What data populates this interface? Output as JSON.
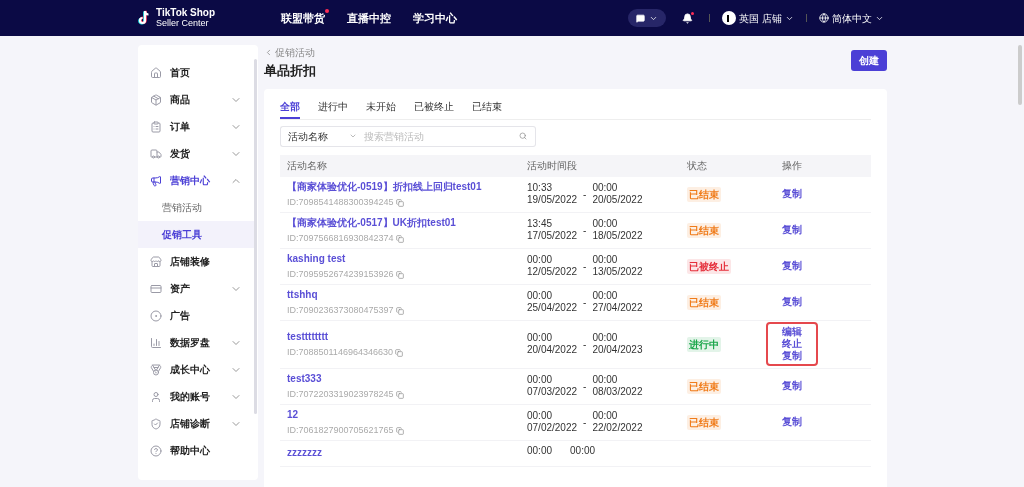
{
  "header": {
    "logo_title": "TikTok Shop",
    "logo_subtitle": "Seller Center",
    "nav": [
      {
        "label": "联盟带货",
        "dot": true
      },
      {
        "label": "直播中控",
        "dot": false
      },
      {
        "label": "学习中心",
        "dot": false
      }
    ],
    "bell_dot": true,
    "store": "英国 店铺",
    "language": "简体中文"
  },
  "sidebar": {
    "items": [
      {
        "label": "首页",
        "selected": false
      },
      {
        "label": "商品",
        "selected": false,
        "expanded": false
      },
      {
        "label": "订单",
        "selected": false,
        "expanded": false
      },
      {
        "label": "发货",
        "selected": false,
        "expanded": false
      },
      {
        "label": "营销中心",
        "selected": true,
        "expanded": true,
        "children": [
          {
            "label": "营销活动",
            "selected": false
          },
          {
            "label": "促销工具",
            "selected": true
          }
        ]
      },
      {
        "label": "店铺装修",
        "selected": false
      },
      {
        "label": "资产",
        "selected": false,
        "expanded": false
      },
      {
        "label": "广告",
        "selected": false
      },
      {
        "label": "数据罗盘",
        "selected": false,
        "expanded": false
      },
      {
        "label": "成长中心",
        "selected": false,
        "expanded": false
      },
      {
        "label": "我的账号",
        "selected": false,
        "expanded": false
      },
      {
        "label": "店铺诊断",
        "selected": false,
        "expanded": false
      },
      {
        "label": "帮助中心",
        "selected": false
      }
    ]
  },
  "breadcrumb": "促销活动",
  "title": "单品折扣",
  "create_button": "创建",
  "tabs": [
    {
      "label": "全部",
      "selected": true
    },
    {
      "label": "进行中",
      "selected": false
    },
    {
      "label": "未开始",
      "selected": false
    },
    {
      "label": "已被终止",
      "selected": false
    },
    {
      "label": "已结束",
      "selected": false
    }
  ],
  "filter": {
    "field": "活动名称",
    "placeholder": "搜索营销活动"
  },
  "table": {
    "columns": [
      "活动名称",
      "活动时间段",
      "状态",
      "操作"
    ],
    "rows": [
      {
        "name": "【商家体验优化-0519】折扣线上回归test01",
        "id": "ID:7098541488300394245",
        "start_time": "10:33",
        "start_date": "19/05/2022",
        "separator": "-",
        "end_time": "00:00",
        "end_date": "20/05/2022",
        "status": {
          "label": "已结束",
          "color": "#f07c1b"
        },
        "actions": [
          "复制"
        ],
        "highlighted": false
      },
      {
        "name": "【商家体验优化-0517】UK折扣test01",
        "id": "ID:7097566816930842374",
        "start_time": "13:45",
        "start_date": "17/05/2022",
        "separator": "-",
        "end_time": "00:00",
        "end_date": "18/05/2022",
        "status": {
          "label": "已结束",
          "color": "#f07c1b"
        },
        "actions": [
          "复制"
        ],
        "highlighted": false
      },
      {
        "name": "kashing test",
        "id": "ID:7095952674239153926",
        "start_time": "00:00",
        "start_date": "12/05/2022",
        "separator": "-",
        "end_time": "00:00",
        "end_date": "13/05/2022",
        "status": {
          "label": "已被终止",
          "color": "#e5303c"
        },
        "actions": [
          "复制"
        ],
        "highlighted": false
      },
      {
        "name": "ttshhq",
        "id": "ID:7090236373080475397",
        "start_time": "00:00",
        "start_date": "25/04/2022",
        "separator": "-",
        "end_time": "00:00",
        "end_date": "27/04/2022",
        "status": {
          "label": "已结束",
          "color": "#f07c1b"
        },
        "actions": [
          "复制"
        ],
        "highlighted": false
      },
      {
        "name": "testttttttt",
        "id": "ID:7088501146964346630",
        "start_time": "00:00",
        "start_date": "20/04/2022",
        "separator": "-",
        "end_time": "00:00",
        "end_date": "20/04/2023",
        "status": {
          "label": "进行中",
          "color": "#1aa64a"
        },
        "actions": [
          "编辑",
          "终止",
          "复制"
        ],
        "highlighted": true
      },
      {
        "name": "test333",
        "id": "ID:7072203319023978245",
        "start_time": "00:00",
        "start_date": "07/03/2022",
        "separator": "-",
        "end_time": "00:00",
        "end_date": "08/03/2022",
        "status": {
          "label": "已结束",
          "color": "#f07c1b"
        },
        "actions": [
          "复制"
        ],
        "highlighted": false
      },
      {
        "name": "12",
        "id": "ID:7061827900705621765",
        "start_time": "00:00",
        "start_date": "07/02/2022",
        "separator": "-",
        "end_time": "00:00",
        "end_date": "22/02/2022",
        "status": {
          "label": "已结束",
          "color": "#f07c1b"
        },
        "actions": [
          "复制"
        ],
        "highlighted": false
      },
      {
        "name": "zzzzzzz",
        "start_time": "00:00",
        "end_time": "00:00"
      }
    ]
  }
}
